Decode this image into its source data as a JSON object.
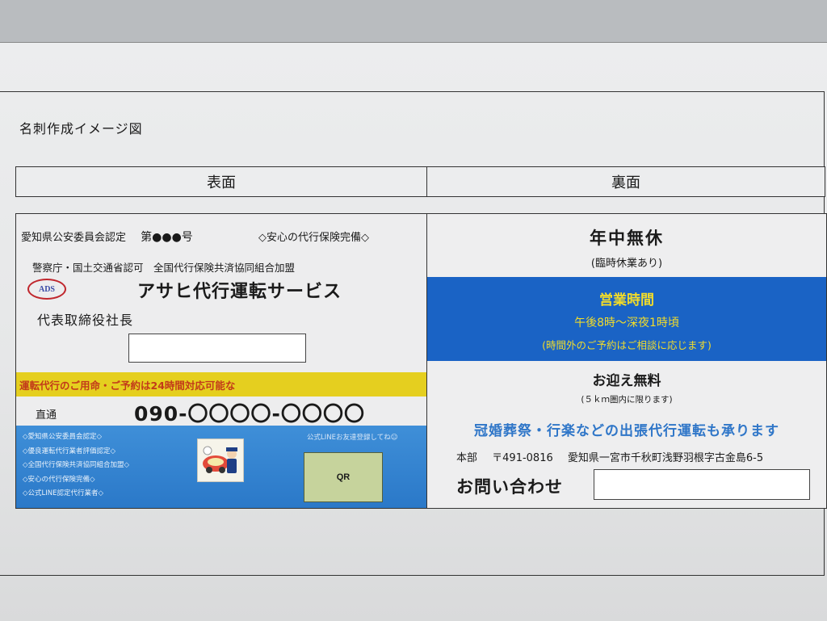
{
  "page_title": "名刺作成イメージ図",
  "sides": {
    "front": "表面",
    "back": "裏面"
  },
  "front": {
    "cert_text": "愛知県公安委員会認定",
    "cert_no": "第●●●号",
    "insurance_complete": "◇安心の代行保険完備◇",
    "approval": "警察庁・国土交通省認可　全国代行保険共済協同組合加盟",
    "logo_text": "ADS",
    "company_name": "アサヒ代行運転サービス",
    "role": "代表取締役社長",
    "band_text": "運転代行のご用命・ご予約は24時間対応可能な",
    "direct_label": "直通",
    "phone": "090-〇〇〇〇-〇〇〇〇",
    "features": [
      "◇愛知県公安委員会認定◇",
      "◇優良運転代行業者評価認定◇",
      "◇全国代行保険共済協同組合加盟◇",
      "◇安心の代行保険完備◇",
      "◇公式LINE認定代行業者◇"
    ],
    "line_caption": "公式LINEお友達登録してね☺",
    "qr_label": "QR"
  },
  "back": {
    "open_year": "年中無休",
    "closed_note": "(臨時休業あり)",
    "hours_title": "営業時間",
    "hours_time": "午後8時～深夜1時頃",
    "hours_note": "(時間外のご予約はご相談に応じます)",
    "pickup": "お迎え無料",
    "radius": "(５ｋｍ圏内に限ります)",
    "services": "冠婚葬祭・行楽などの出張代行運転も承ります",
    "hq_label": "本部",
    "postal": "〒491-0816",
    "address": "愛知県一宮市千秋町浅野羽根字古金島6-5",
    "inquiry_label": "お問い合わせ"
  },
  "colors": {
    "yellow_band": "#e5cf1f",
    "front_blue": "#2a78c8",
    "hours_blue": "#1a63c5",
    "hours_text": "#f2dc2a",
    "services_text": "#2f76c8"
  }
}
